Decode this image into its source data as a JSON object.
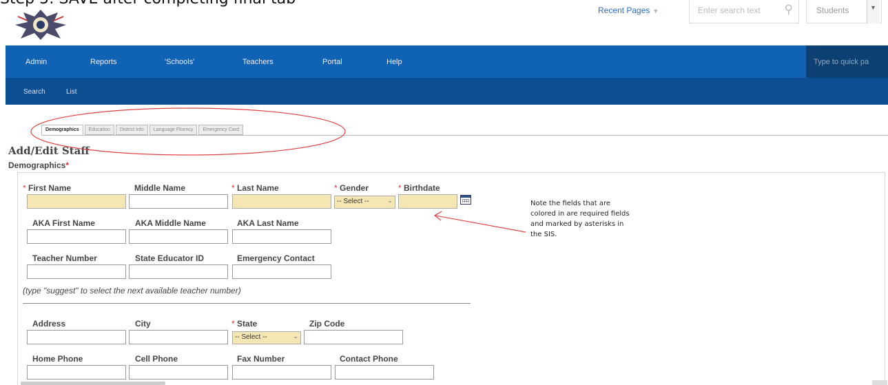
{
  "step_title": "Step 5: SAVE after completing final tab",
  "header": {
    "recent_pages": "Recent Pages",
    "search_placeholder": "Enter search text",
    "student_selector": "Students"
  },
  "nav": {
    "items": [
      "Admin",
      "Reports",
      "'Schools'",
      "Teachers",
      "Portal",
      "Help"
    ],
    "quick_placeholder": "Type to quick pa"
  },
  "subnav": {
    "items": [
      "Search",
      "List"
    ]
  },
  "tabs": [
    "Demographics",
    "Education",
    "District Info",
    "Language Fluency",
    "Emergency Card"
  ],
  "page_title": "Add/Edit Staff",
  "section_title": "Demographics",
  "fields": {
    "first_name": "First Name",
    "middle_name": "Middle Name",
    "last_name": "Last Name",
    "gender": "Gender",
    "birthdate": "Birthdate",
    "aka_first_name": "AKA First Name",
    "aka_middle_name": "AKA Middle Name",
    "aka_last_name": "AKA Last Name",
    "teacher_number": "Teacher Number",
    "state_educator_id": "State Educator ID",
    "emergency_contact": "Emergency Contact",
    "address": "Address",
    "city": "City",
    "state": "State",
    "zip_code": "Zip Code",
    "home_phone": "Home Phone",
    "cell_phone": "Cell Phone",
    "fax_number": "Fax Number",
    "contact_phone": "Contact Phone"
  },
  "gender_select_value": "-- Select --",
  "state_select_value": "-- Select --",
  "hint": "(type \"suggest\" to select the next available teacher number)",
  "note": "Note the fields that are colored in are required fields and marked by asterisks in the SIS.",
  "required_marker": "*",
  "colors": {
    "nav_bg": "#1062b4",
    "subnav_bg": "#0c4f93",
    "required_fill": "#f5e7b4",
    "annotation": "#e04040"
  },
  "icons": [
    "logo",
    "search-icon",
    "dropdown-arrow-icon",
    "calendar-icon"
  ]
}
